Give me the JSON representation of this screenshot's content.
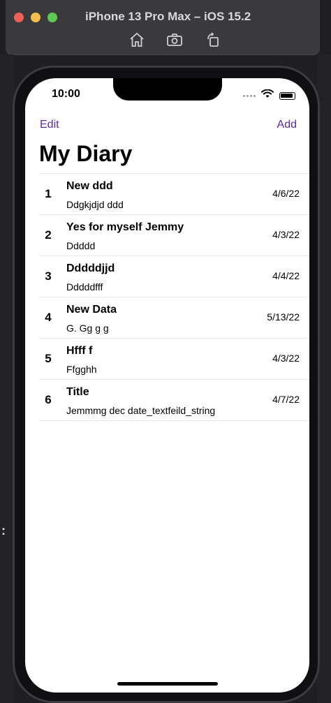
{
  "window": {
    "title": "iPhone 13 Pro Max – iOS 15.2"
  },
  "status_bar": {
    "time": "10:00"
  },
  "nav": {
    "edit_label": "Edit",
    "add_label": "Add",
    "title": "My Diary"
  },
  "entries": [
    {
      "num": "1",
      "title": "New ddd",
      "subtitle": "Ddgkjdjd ddd",
      "date": "4/6/22"
    },
    {
      "num": "2",
      "title": "Yes for myself Jemmy",
      "subtitle": "Ddddd",
      "date": "4/3/22"
    },
    {
      "num": "3",
      "title": "Dddddjjd",
      "subtitle": "Dddddfff",
      "date": "4/4/22"
    },
    {
      "num": "4",
      "title": "New Data",
      "subtitle": "G. Gg g g",
      "date": "5/13/22"
    },
    {
      "num": "5",
      "title": "Hfff f",
      "subtitle": "Ffgghh",
      "date": "4/3/22"
    },
    {
      "num": "6",
      "title": "Title",
      "subtitle": "Jemmmg dec date_textfeild_string",
      "date": "4/7/22"
    }
  ],
  "colors": {
    "accent": "#5b27a4",
    "red": "#ee5f58",
    "yellow": "#f4be4f",
    "green": "#5ec854"
  },
  "icons": [
    "home-icon",
    "screenshot-icon",
    "rotate-icon",
    "wifi-icon",
    "battery-icon",
    "cellular-signal-icon"
  ]
}
